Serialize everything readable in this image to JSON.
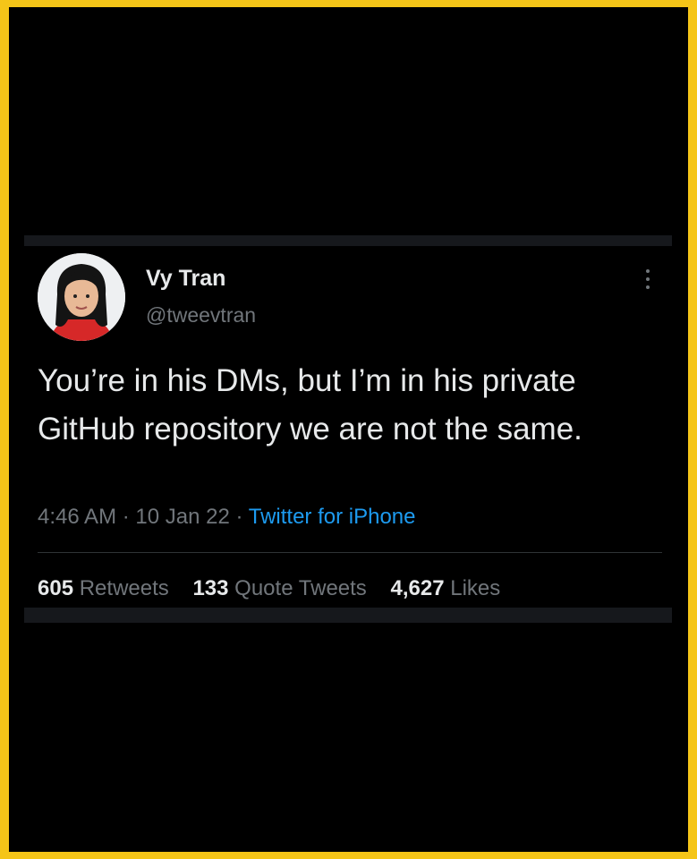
{
  "tweet": {
    "display_name": "Vy Tran",
    "handle": "@tweevtran",
    "text": "You’re in his DMs, but I’m in his private GitHub repository we are not the same.",
    "time": "4:46 AM",
    "separator": "·",
    "date": "10 Jan 22",
    "source": "Twitter for iPhone",
    "stats": {
      "retweets_count": "605",
      "retweets_label": "Retweets",
      "quotes_count": "133",
      "quotes_label": "Quote Tweets",
      "likes_count": "4,627",
      "likes_label": "Likes"
    },
    "more_icon": "more-vertical-icon"
  },
  "colors": {
    "frame_border": "#f5c518",
    "background": "#000000",
    "primary_text": "#e7e9ea",
    "secondary_text": "#71767b",
    "link": "#1d9bf0"
  }
}
